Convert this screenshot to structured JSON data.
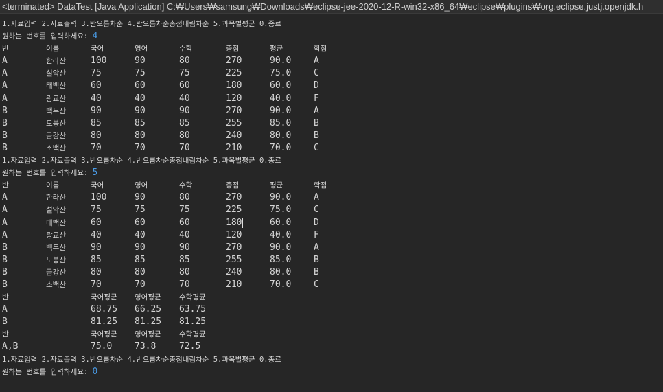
{
  "window": {
    "title": "<terminated> DataTest [Java Application] C:₩Users₩samsung₩Downloads₩eclipse-jee-2020-12-R-win32-x86_64₩eclipse₩plugins₩org.eclipse.justj.openjdk.h"
  },
  "colors": {
    "background": "#262626",
    "text": "#d4d4d4",
    "input": "#4a9be6"
  },
  "console": {
    "menu": "1.자료입력 2.자료출력 3.반오름차순 4.반오름차순총점내림차순 5.과목별평균 0.종료",
    "prompt": "원하는 번호를 입력하세요: ",
    "inputs": [
      "4",
      "5",
      "0"
    ],
    "header": [
      "반",
      "이름",
      "국어",
      "영어",
      "수학",
      "총점",
      "평균",
      "학점"
    ],
    "rows": [
      [
        "A",
        "한라산",
        "100",
        "90",
        "80",
        "270",
        "90.0",
        "A"
      ],
      [
        "A",
        "설악산",
        "75",
        "75",
        "75",
        "225",
        "75.0",
        "C"
      ],
      [
        "A",
        "태백산",
        "60",
        "60",
        "60",
        "180",
        "60.0",
        "D"
      ],
      [
        "A",
        "광교산",
        "40",
        "40",
        "40",
        "120",
        "40.0",
        "F"
      ],
      [
        "B",
        "백두산",
        "90",
        "90",
        "90",
        "270",
        "90.0",
        "A"
      ],
      [
        "B",
        "도봉산",
        "85",
        "85",
        "85",
        "255",
        "85.0",
        "B"
      ],
      [
        "B",
        "금강산",
        "80",
        "80",
        "80",
        "240",
        "80.0",
        "B"
      ],
      [
        "B",
        "소백산",
        "70",
        "70",
        "70",
        "210",
        "70.0",
        "C"
      ]
    ],
    "avg_header": [
      "반",
      "국어평균",
      "영어평균",
      "수학평균"
    ],
    "avg_rows": [
      [
        "A",
        "68.75",
        "66.25",
        "63.75"
      ],
      [
        "B",
        "81.25",
        "81.25",
        "81.25"
      ]
    ],
    "total_header": [
      "반",
      "국어평균",
      "영어평균",
      "수학평균"
    ],
    "total_row": [
      "A,B",
      "75.0",
      "73.8",
      "72.5"
    ]
  }
}
